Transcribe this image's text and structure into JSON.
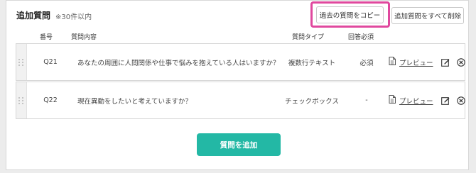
{
  "section": {
    "title": "追加質問",
    "note": "※30件以内"
  },
  "toolbar": {
    "copy_label": "過去の質問をコピー",
    "delete_all_label": "追加質問をすべて削除"
  },
  "table": {
    "headers": {
      "number": "番号",
      "content": "質問内容",
      "type": "質問タイプ",
      "required": "回答必須"
    },
    "rows": [
      {
        "number": "Q21",
        "content": "あなたの周囲に人間関係や仕事で悩みを抱えている人はいますか？",
        "type": "複数行テキスト",
        "required": "必須",
        "preview": "プレビュー"
      },
      {
        "number": "Q22",
        "content": "現在異動をしたいと考えていますか？",
        "type": "チェックボックス",
        "required": "-",
        "preview": "プレビュー"
      }
    ]
  },
  "footer": {
    "add_label": "質問を追加"
  },
  "colors": {
    "accent": "#23b8a5",
    "highlight": "#e0489e"
  }
}
